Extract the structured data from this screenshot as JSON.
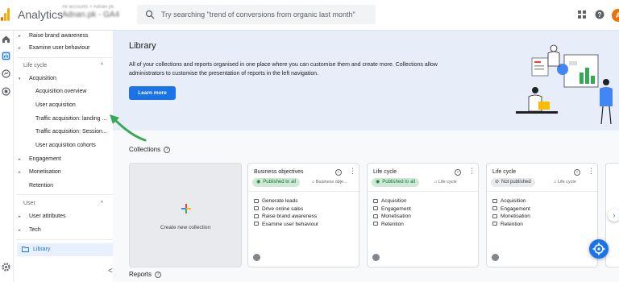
{
  "header": {
    "app_title": "Analytics",
    "account_small": "All accounts > Adnan pk",
    "account_main": "Adnan.pk - GA4",
    "search_placeholder": "Try searching \"trend of conversions from organic last month\"",
    "avatar_letter": "A"
  },
  "sidenav": {
    "items": [
      {
        "label": "Raise brand awareness",
        "caret": "▸"
      },
      {
        "label": "Examine user behaviour",
        "caret": "▸"
      },
      {
        "label": "Life cycle",
        "chevron": "^"
      },
      {
        "label": "Acquisition",
        "caret": "▾"
      },
      {
        "label": "Acquisition overview"
      },
      {
        "label": "User acquisition"
      },
      {
        "label": "Traffic acquisition: landing ..."
      },
      {
        "label": "Traffic acquisition: Session..."
      },
      {
        "label": "User acquisition cohorts"
      },
      {
        "label": "Engagement",
        "caret": "▸"
      },
      {
        "label": "Monetisation",
        "caret": "▸"
      },
      {
        "label": "Retention"
      },
      {
        "label": "User",
        "chevron": "^"
      },
      {
        "label": "User attributes",
        "caret": "▸"
      },
      {
        "label": "Tech",
        "caret": "▸"
      }
    ],
    "library_label": "Library",
    "collapse": "<"
  },
  "hero": {
    "title": "Library",
    "description": "All of your collections and reports organised in one place where you can customise them and create more. Collections allow administrators to customise the presentation of reports in the left navigation.",
    "button": "Learn more"
  },
  "collections": {
    "title": "Collections",
    "create_label": "Create new collection",
    "cards": [
      {
        "title": "Business objectives",
        "status": "Published to all",
        "topic": "Business obje...",
        "items": [
          "Generate leads",
          "Drive online sales",
          "Raise brand awareness",
          "Examine user behaviour"
        ]
      },
      {
        "title": "Life cycle",
        "status": "Published to all",
        "topic": "Life cycle",
        "items": [
          "Acquisition",
          "Engagement",
          "Monetisation",
          "Retention"
        ]
      },
      {
        "title": "Life cycle",
        "status": "Not published",
        "topic": "Life cycle",
        "items": [
          "Acquisition",
          "Engagement",
          "Monetisation",
          "Retention"
        ]
      }
    ],
    "next": "›"
  },
  "reports": {
    "title": "Reports"
  },
  "colors": {
    "accent": "#1a73e8",
    "hero_bg": "#e8eef9",
    "published_bg": "#ceead6",
    "published_fg": "#137333",
    "arrow": "#34a853",
    "logo_orange": "#f9ab00",
    "logo_dark": "#e37400"
  },
  "icons": [
    "analytics-logo-icon",
    "search-icon",
    "apps-grid-icon",
    "help-icon",
    "home-icon",
    "reports-icon",
    "explore-icon",
    "advertising-icon",
    "settings-icon",
    "folder-icon",
    "info-icon",
    "more-vert-icon",
    "eye-icon",
    "eye-off-icon",
    "label-icon",
    "plus-icon",
    "chevron-right-icon",
    "fab-icon"
  ]
}
